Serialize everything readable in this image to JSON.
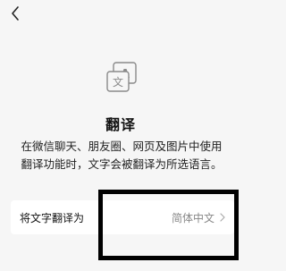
{
  "icons": {
    "back": "chevron-left-icon",
    "feature": "translate-icon",
    "row_arrow": "chevron-right-icon"
  },
  "colors": {
    "background": "#f6f6f6",
    "card": "#ffffff",
    "text": "#111111",
    "secondary_text": "#888888",
    "icon_gray": "#8a8a8a",
    "highlight": "#000000"
  },
  "feature": {
    "icon_letters": {
      "latin": "A",
      "chinese": "文"
    },
    "title": "翻译",
    "description_lines": [
      "在微信聊天、朋友圈、网页及图片中使用",
      "翻译功能时，文字会被翻译为所选语言。"
    ]
  },
  "setting": {
    "label": "将文字翻译为",
    "value": "简体中文"
  }
}
